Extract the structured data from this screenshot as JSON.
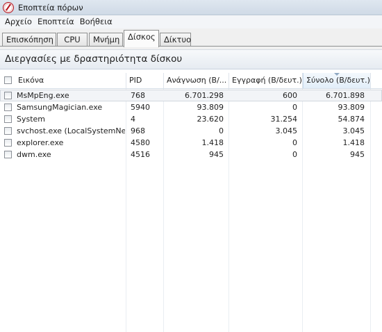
{
  "window": {
    "title": "Εποπτεία πόρων"
  },
  "menu": {
    "items": [
      "Αρχείο",
      "Εποπτεία",
      "Βοήθεια"
    ]
  },
  "tabs": [
    "Επισκόπηση",
    "CPU",
    "Μνήμη",
    "Δίσκος",
    "Δίκτυο"
  ],
  "active_tab": "Δίσκος",
  "section": {
    "title": "Διεργασίες με δραστηριότητα δίσκου"
  },
  "table": {
    "columns": [
      "Εικόνα",
      "PID",
      "Ανάγνωση (B/...",
      "Εγγραφή (B/δευτ.)",
      "Σύνολο (B/δευτ.)"
    ],
    "sorted_column": "Σύνολο (B/δευτ.)",
    "rows": [
      {
        "image": "MsMpEng.exe",
        "pid": "768",
        "read": "6.701.298",
        "write": "600",
        "total": "6.701.898"
      },
      {
        "image": "SamsungMagician.exe",
        "pid": "5940",
        "read": "93.809",
        "write": "0",
        "total": "93.809"
      },
      {
        "image": "System",
        "pid": "4",
        "read": "23.620",
        "write": "31.254",
        "total": "54.874"
      },
      {
        "image": "svchost.exe (LocalSystemNet...",
        "pid": "968",
        "read": "0",
        "write": "3.045",
        "total": "3.045"
      },
      {
        "image": "explorer.exe",
        "pid": "4580",
        "read": "1.418",
        "write": "0",
        "total": "1.418"
      },
      {
        "image": "dwm.exe",
        "pid": "4516",
        "read": "945",
        "write": "0",
        "total": "945"
      }
    ]
  }
}
